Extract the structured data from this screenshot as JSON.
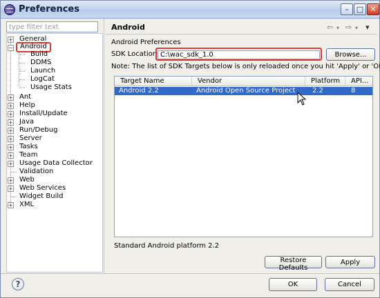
{
  "window": {
    "title": "Preferences"
  },
  "filter": {
    "placeholder": "type filter text"
  },
  "tree": {
    "items": [
      {
        "label": "General",
        "expander": "+"
      },
      {
        "label": "Android",
        "expander": "−"
      },
      {
        "label": "Build"
      },
      {
        "label": "DDMS"
      },
      {
        "label": "Launch"
      },
      {
        "label": "LogCat"
      },
      {
        "label": "Usage Stats"
      },
      {
        "label": "Ant",
        "expander": "+"
      },
      {
        "label": "Help",
        "expander": "+"
      },
      {
        "label": "Install/Update",
        "expander": "+"
      },
      {
        "label": "Java",
        "expander": "+"
      },
      {
        "label": "Run/Debug",
        "expander": "+"
      },
      {
        "label": "Server",
        "expander": "+"
      },
      {
        "label": "Tasks",
        "expander": "+"
      },
      {
        "label": "Team",
        "expander": "+"
      },
      {
        "label": "Usage Data Collector",
        "expander": "+"
      },
      {
        "label": "Validation"
      },
      {
        "label": "Web",
        "expander": "+"
      },
      {
        "label": "Web Services",
        "expander": "+"
      },
      {
        "label": "Widget Build"
      },
      {
        "label": "XML",
        "expander": "+"
      }
    ]
  },
  "page": {
    "title": "Android",
    "nav_back": "⇦",
    "nav_forward": "⇨",
    "menu": "▾",
    "section": "Android Preferences",
    "sdk_label": "SDK Location:",
    "sdk_value": "C:\\wac_sdk_1.0",
    "browse": "Browse...",
    "note": "Note: The list of SDK Targets below is only reloaded once you hit 'Apply' or 'OK'.",
    "table": {
      "headers": [
        "Target Name",
        "Vendor",
        "Platform",
        "API..."
      ],
      "rows": [
        [
          "Android 2.2",
          "Android Open Source Project",
          "2.2",
          "8"
        ]
      ]
    },
    "description": "Standard Android platform 2.2",
    "restore_defaults": "Restore Defaults",
    "apply": "Apply"
  },
  "footer": {
    "help": "?",
    "ok": "OK",
    "cancel": "Cancel"
  },
  "colors": {
    "highlight_red": "#d83a32",
    "selection_blue": "#3169c6"
  }
}
